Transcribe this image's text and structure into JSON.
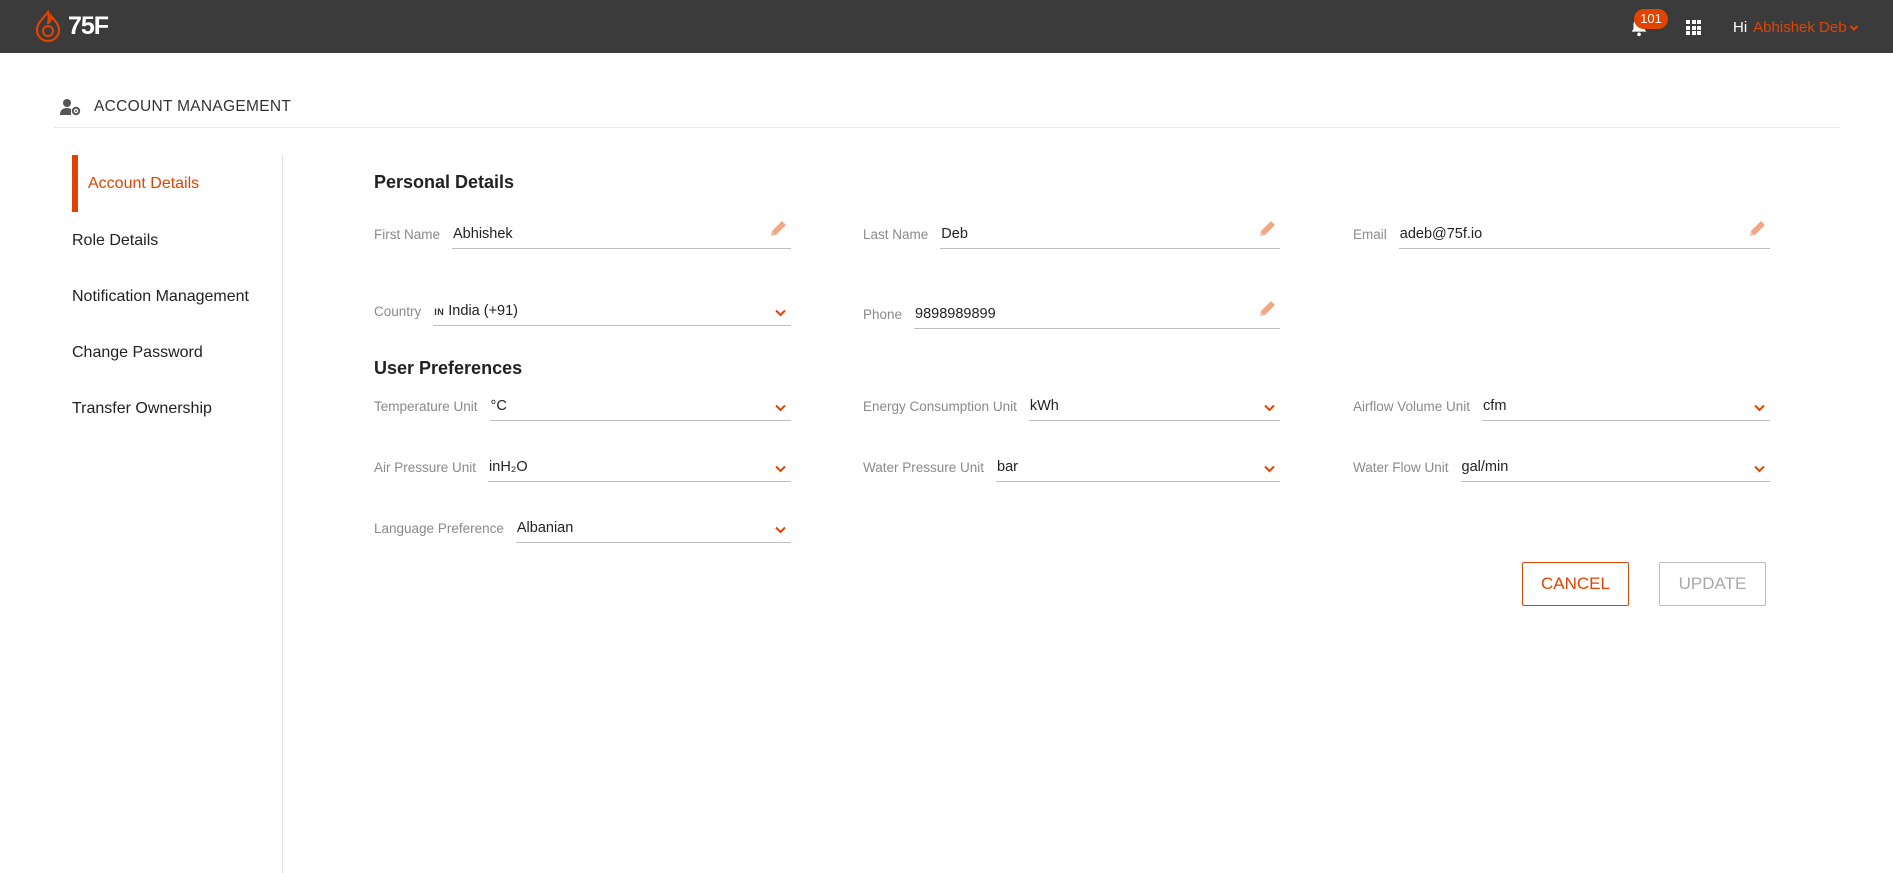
{
  "brand": {
    "name": "75F",
    "accent": "#e24301",
    "topbar_bg": "#3b3b3b"
  },
  "topbar": {
    "notification_count": "101",
    "greeting": "Hi",
    "user_name": "Abhishek Deb"
  },
  "page": {
    "title": "ACCOUNT MANAGEMENT"
  },
  "sidebar": {
    "items": [
      {
        "label": "Account Details",
        "active": true
      },
      {
        "label": "Role Details"
      },
      {
        "label": "Notification Management"
      },
      {
        "label": "Change Password"
      },
      {
        "label": "Transfer Ownership"
      }
    ]
  },
  "personal": {
    "title": "Personal Details",
    "first_name": {
      "label": "First Name",
      "value": "Abhishek"
    },
    "last_name": {
      "label": "Last Name",
      "value": "Deb"
    },
    "email": {
      "label": "Email",
      "value": "adeb@75f.io"
    },
    "country": {
      "label": "Country",
      "flag": "IN",
      "value": "India (+91)"
    },
    "phone": {
      "label": "Phone",
      "value": "9898989899"
    }
  },
  "preferences": {
    "title": "User Preferences",
    "temperature": {
      "label": "Temperature Unit",
      "value": "°C"
    },
    "energy": {
      "label": "Energy Consumption Unit",
      "value": "kWh"
    },
    "airflow": {
      "label": "Airflow Volume Unit",
      "value": "cfm"
    },
    "air_pressure": {
      "label": "Air Pressure Unit",
      "value": "inH₂O"
    },
    "water_pressure": {
      "label": "Water Pressure Unit",
      "value": "bar"
    },
    "water_flow": {
      "label": "Water Flow Unit",
      "value": "gal/min"
    },
    "language": {
      "label": "Language Preference",
      "value": "Albanian"
    }
  },
  "actions": {
    "cancel": "CANCEL",
    "update": "UPDATE"
  }
}
